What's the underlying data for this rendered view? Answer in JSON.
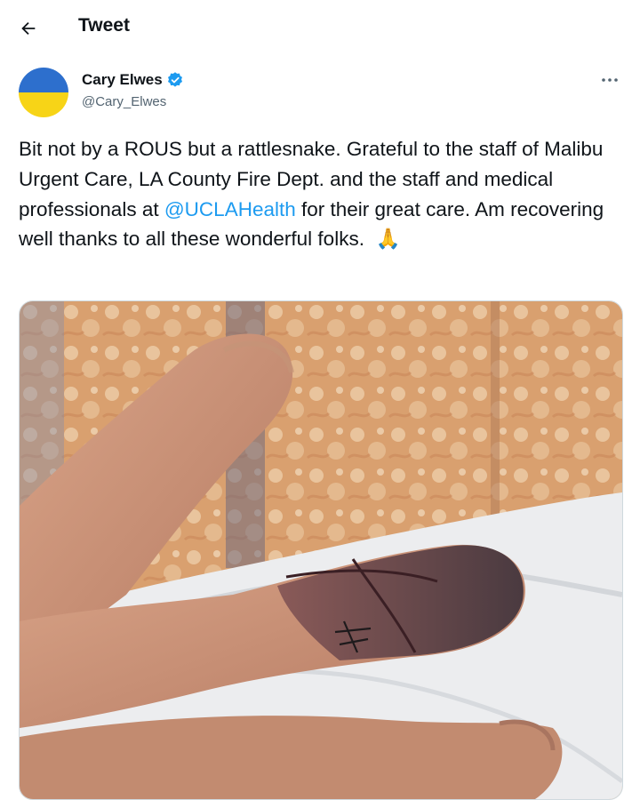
{
  "header": {
    "title": "Tweet",
    "back_icon": "arrow-left-icon"
  },
  "author": {
    "name": "Cary Elwes",
    "handle": "@Cary_Elwes",
    "verified_icon": "verified-badge-icon",
    "avatar_colors": [
      "#2d6fcd",
      "#f7d417"
    ]
  },
  "more_icon": "more-dots-icon",
  "tweet": {
    "text_before": "Bit not by a ROUS but a rattlesnake. Grateful to the staff of Malibu Urgent Care, LA County Fire Dept. and the staff and medical professionals at ",
    "mention": "@UCLAHealth",
    "text_after": " for their great care. Am recovering well thanks to all these wonderful folks.  ",
    "emoji": "🙏"
  },
  "media": {
    "type": "photo",
    "subject": "hand-photo"
  },
  "colors": {
    "accent": "#1d9bf0",
    "text": "#0f1419",
    "muted": "#536471"
  }
}
